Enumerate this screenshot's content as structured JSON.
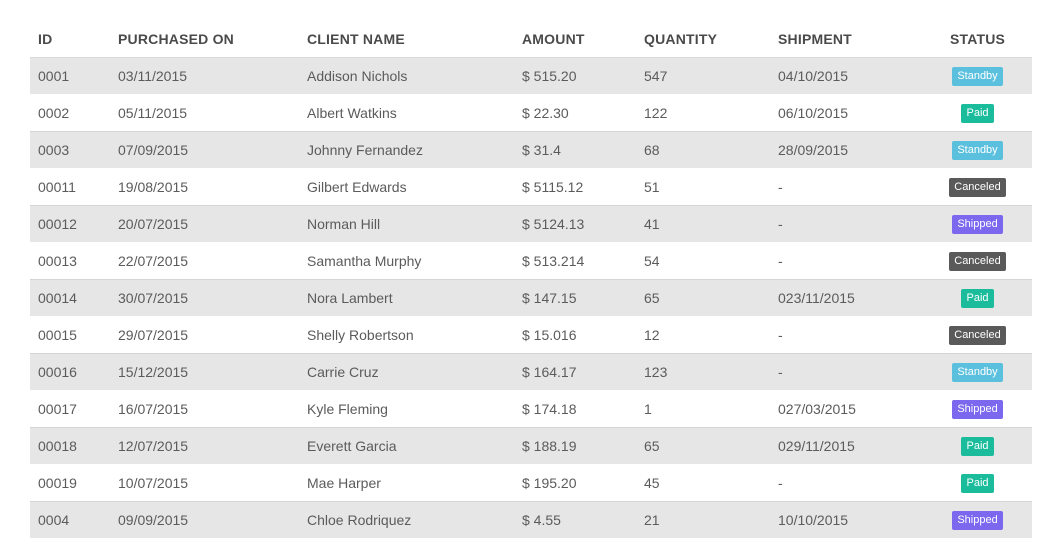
{
  "table": {
    "headers": {
      "id": "ID",
      "purchased_on": "PURCHASED ON",
      "client_name": "CLIENT NAME",
      "amount": "AMOUNT",
      "quantity": "QUANTITY",
      "shipment": "SHIPMENT",
      "status": "STATUS"
    },
    "status_colors": {
      "Standby": "#5bc0de",
      "Paid": "#1abc9c",
      "Canceled": "#5a5a5a",
      "Shipped": "#7b68ee"
    },
    "rows": [
      {
        "id": "0001",
        "purchased_on": "03/11/2015",
        "client_name": "Addison Nichols",
        "amount": "$ 515.20",
        "quantity": "547",
        "shipment": "04/10/2015",
        "status": "Standby"
      },
      {
        "id": "0002",
        "purchased_on": "05/11/2015",
        "client_name": "Albert Watkins",
        "amount": "$ 22.30",
        "quantity": "122",
        "shipment": "06/10/2015",
        "status": "Paid"
      },
      {
        "id": "0003",
        "purchased_on": "07/09/2015",
        "client_name": "Johnny Fernandez",
        "amount": "$ 31.4",
        "quantity": "68",
        "shipment": "28/09/2015",
        "status": "Standby"
      },
      {
        "id": "00011",
        "purchased_on": "19/08/2015",
        "client_name": "Gilbert Edwards",
        "amount": "$ 5115.12",
        "quantity": "51",
        "shipment": "-",
        "status": "Canceled"
      },
      {
        "id": "00012",
        "purchased_on": "20/07/2015",
        "client_name": "Norman Hill",
        "amount": "$ 5124.13",
        "quantity": "41",
        "shipment": "-",
        "status": "Shipped"
      },
      {
        "id": "00013",
        "purchased_on": "22/07/2015",
        "client_name": "Samantha Murphy",
        "amount": "$ 513.214",
        "quantity": "54",
        "shipment": "-",
        "status": "Canceled"
      },
      {
        "id": "00014",
        "purchased_on": "30/07/2015",
        "client_name": "Nora Lambert",
        "amount": "$ 147.15",
        "quantity": "65",
        "shipment": "023/11/2015",
        "status": "Paid"
      },
      {
        "id": "00015",
        "purchased_on": "29/07/2015",
        "client_name": "Shelly Robertson",
        "amount": "$ 15.016",
        "quantity": "12",
        "shipment": "-",
        "status": "Canceled"
      },
      {
        "id": "00016",
        "purchased_on": "15/12/2015",
        "client_name": "Carrie Cruz",
        "amount": "$ 164.17",
        "quantity": "123",
        "shipment": "-",
        "status": "Standby"
      },
      {
        "id": "00017",
        "purchased_on": "16/07/2015",
        "client_name": "Kyle Fleming",
        "amount": "$ 174.18",
        "quantity": "1",
        "shipment": "027/03/2015",
        "status": "Shipped"
      },
      {
        "id": "00018",
        "purchased_on": "12/07/2015",
        "client_name": "Everett Garcia",
        "amount": "$ 188.19",
        "quantity": "65",
        "shipment": "029/11/2015",
        "status": "Paid"
      },
      {
        "id": "00019",
        "purchased_on": "10/07/2015",
        "client_name": "Mae Harper",
        "amount": "$ 195.20",
        "quantity": "45",
        "shipment": "-",
        "status": "Paid"
      },
      {
        "id": "0004",
        "purchased_on": "09/09/2015",
        "client_name": "Chloe Rodriquez",
        "amount": "$ 4.55",
        "quantity": "21",
        "shipment": "10/10/2015",
        "status": "Shipped"
      }
    ]
  }
}
